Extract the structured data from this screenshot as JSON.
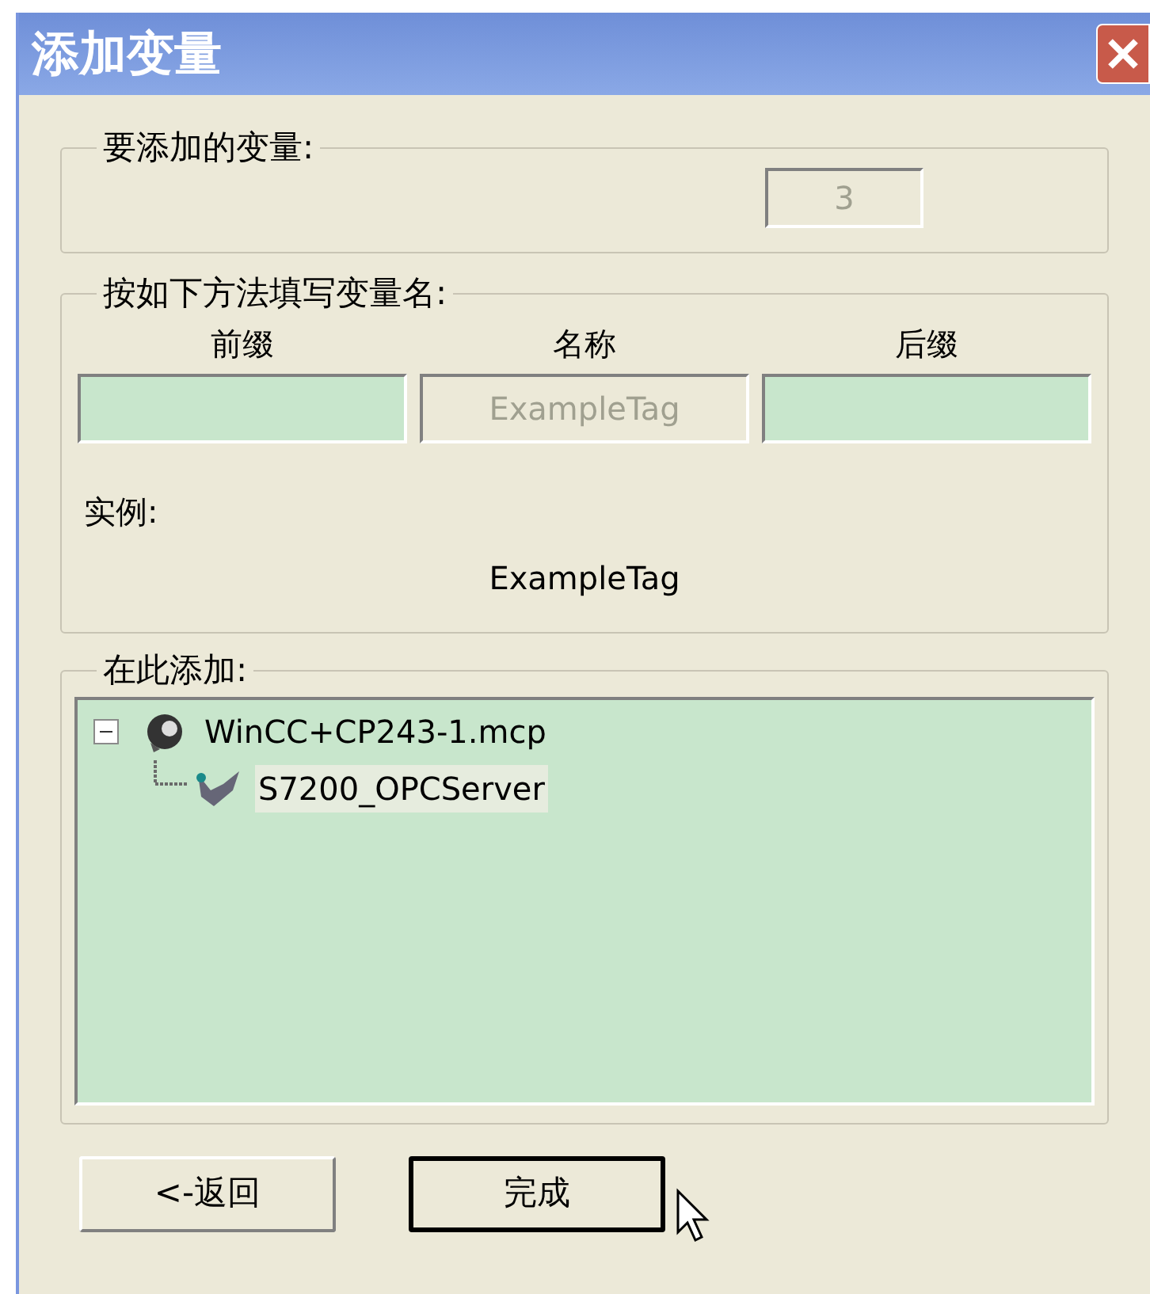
{
  "window": {
    "title": "添加变量"
  },
  "count_group": {
    "label": "要添加的变量:",
    "count": {
      "value": "3",
      "disabled": true
    }
  },
  "name_group": {
    "label": "按如下方法填写变量名:",
    "fields": [
      {
        "label": "前缀",
        "disabled": false
      },
      {
        "label": "名称",
        "value": "ExampleTag",
        "disabled": true
      },
      {
        "label": "后缀",
        "disabled": false
      }
    ],
    "example_label": "实例:",
    "example_value": "ExampleTag"
  },
  "target_group": {
    "label": "在此添加:",
    "tree": [
      {
        "label": "WinCC+CP243-1.mcp",
        "expanded": true,
        "selected": false,
        "children": [
          {
            "label": "S7200_OPCServer",
            "selected": true
          }
        ]
      }
    ]
  },
  "buttons": [
    {
      "label": "<-返回",
      "default": false
    },
    {
      "label": "完成",
      "default": true
    }
  ]
}
